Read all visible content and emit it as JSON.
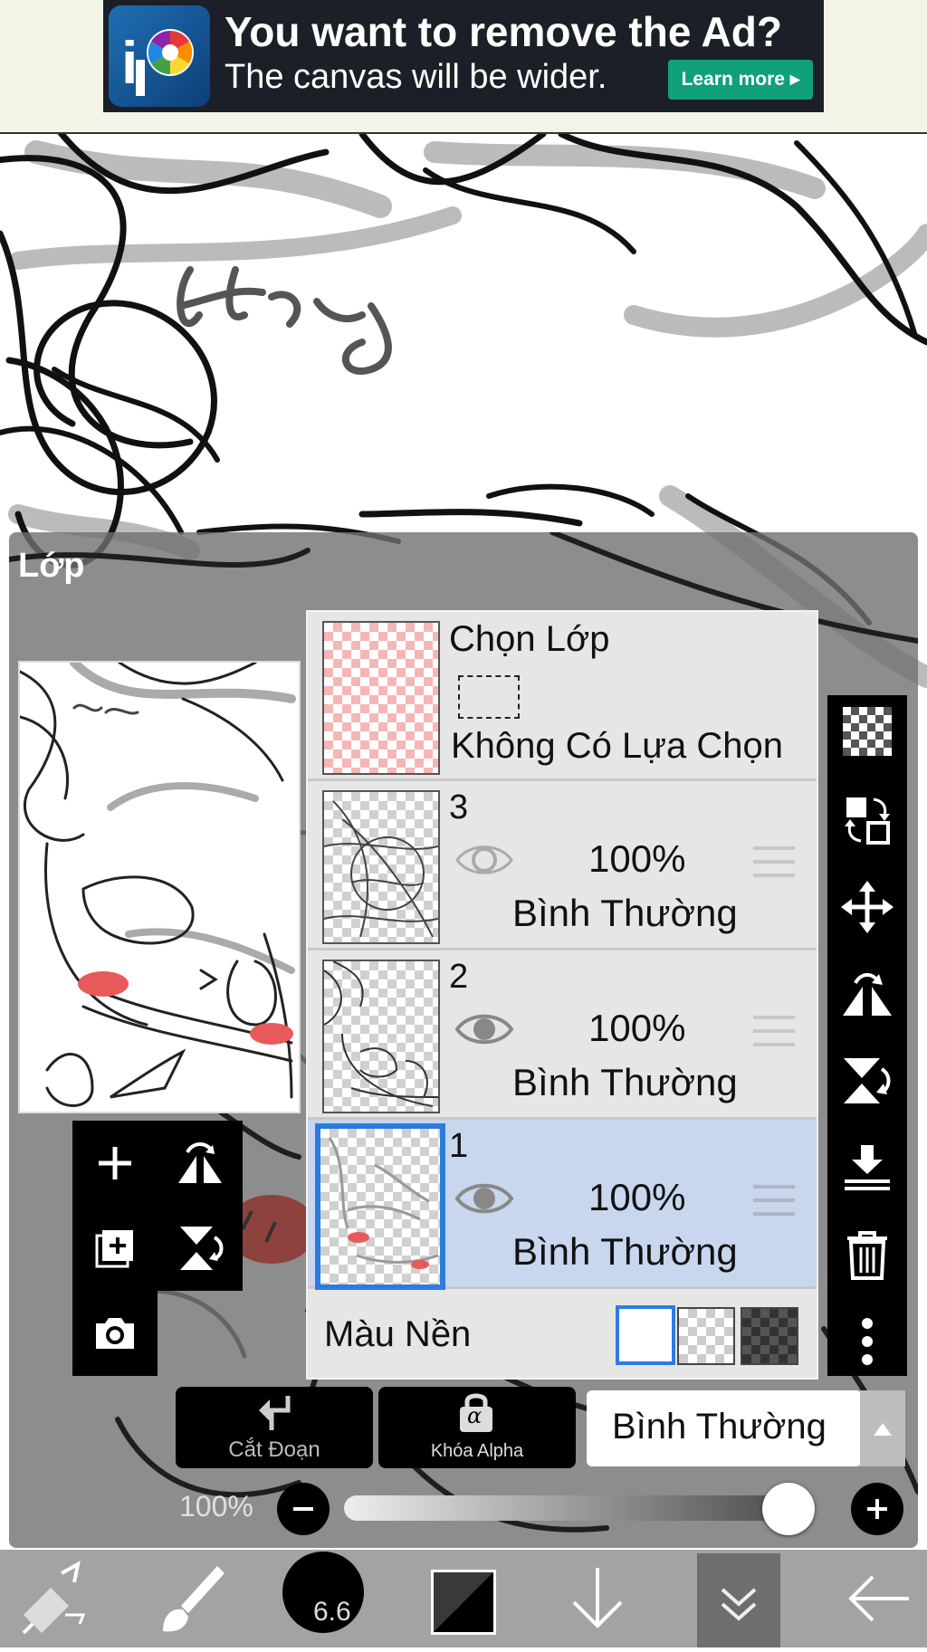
{
  "ad": {
    "headline": "You want to remove the Ad?",
    "subline": "The canvas will be wider.",
    "learn_more": "Learn more",
    "logo_icon": "ibispaint-logo-icon"
  },
  "canvas": {
    "signature_text": "Haaty"
  },
  "layer_panel": {
    "title": "Lớp",
    "selection_row": {
      "title": "Chọn Lớp",
      "status": "Không Có Lựa Chọn"
    },
    "layers": [
      {
        "number": "3",
        "opacity": "100%",
        "blend": "Bình Thường",
        "visible": true,
        "selected": false
      },
      {
        "number": "2",
        "opacity": "100%",
        "blend": "Bình Thường",
        "visible": true,
        "selected": false
      },
      {
        "number": "1",
        "opacity": "100%",
        "blend": "Bình Thường",
        "visible": true,
        "selected": true
      }
    ],
    "background": {
      "label": "Màu Nền",
      "options": [
        "white",
        "transparent",
        "dark-checker"
      ],
      "selected": "white"
    },
    "clipping_label": "Cắt Đoạn",
    "alpha_lock_label": "Khóa Alpha",
    "alpha_symbol": "α",
    "blend_mode_value": "Bình Thường",
    "opacity_label": "100%",
    "opacity_value": 1.0,
    "right_toolbar_icons": [
      "transparent-checker-icon",
      "swap-layer-icon",
      "move-icon",
      "flip-horizontal-icon",
      "flip-vertical-icon",
      "merge-down-icon",
      "trash-icon",
      "more-icon"
    ],
    "left_toolbox_icons": [
      "add-layer-icon",
      "flip-horizontal-icon",
      "duplicate-layer-icon",
      "flip-vertical-icon",
      "camera-icon"
    ]
  },
  "bottom_bar": {
    "brush_size": "6.6",
    "icons": [
      "transform-tool-icon",
      "brush-icon",
      "brush-size-icon",
      "color-swatch-icon",
      "arrow-down-icon",
      "collapse-icon",
      "back-arrow-icon"
    ]
  },
  "colors": {
    "accent_blue": "#2e7be0",
    "selected_row": "#c8d6ee",
    "ad_button": "#10a07a",
    "blush": "#e85a5a"
  }
}
